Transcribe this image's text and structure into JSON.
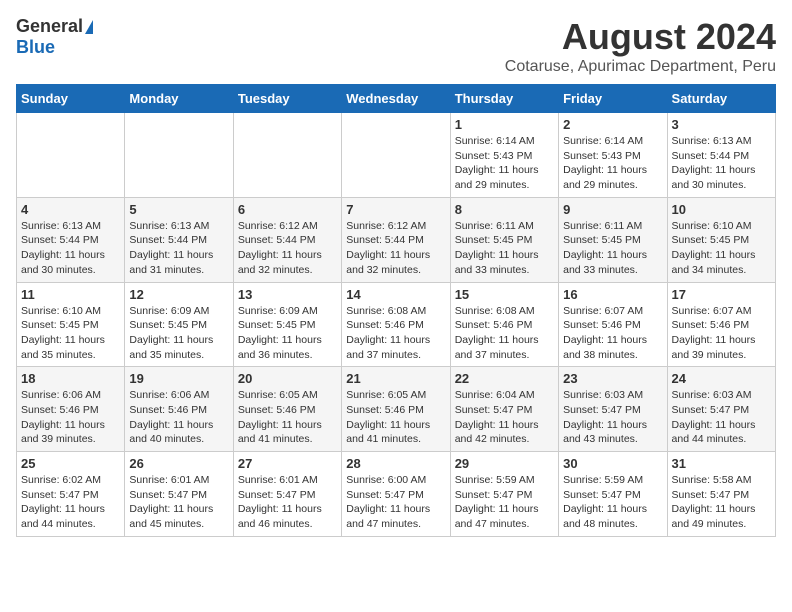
{
  "logo": {
    "general": "General",
    "blue": "Blue"
  },
  "title": "August 2024",
  "subtitle": "Cotaruse, Apurimac Department, Peru",
  "days_of_week": [
    "Sunday",
    "Monday",
    "Tuesday",
    "Wednesday",
    "Thursday",
    "Friday",
    "Saturday"
  ],
  "weeks": [
    [
      {
        "day": "",
        "info": ""
      },
      {
        "day": "",
        "info": ""
      },
      {
        "day": "",
        "info": ""
      },
      {
        "day": "",
        "info": ""
      },
      {
        "day": "1",
        "info": "Sunrise: 6:14 AM\nSunset: 5:43 PM\nDaylight: 11 hours\nand 29 minutes."
      },
      {
        "day": "2",
        "info": "Sunrise: 6:14 AM\nSunset: 5:43 PM\nDaylight: 11 hours\nand 29 minutes."
      },
      {
        "day": "3",
        "info": "Sunrise: 6:13 AM\nSunset: 5:44 PM\nDaylight: 11 hours\nand 30 minutes."
      }
    ],
    [
      {
        "day": "4",
        "info": "Sunrise: 6:13 AM\nSunset: 5:44 PM\nDaylight: 11 hours\nand 30 minutes."
      },
      {
        "day": "5",
        "info": "Sunrise: 6:13 AM\nSunset: 5:44 PM\nDaylight: 11 hours\nand 31 minutes."
      },
      {
        "day": "6",
        "info": "Sunrise: 6:12 AM\nSunset: 5:44 PM\nDaylight: 11 hours\nand 32 minutes."
      },
      {
        "day": "7",
        "info": "Sunrise: 6:12 AM\nSunset: 5:44 PM\nDaylight: 11 hours\nand 32 minutes."
      },
      {
        "day": "8",
        "info": "Sunrise: 6:11 AM\nSunset: 5:45 PM\nDaylight: 11 hours\nand 33 minutes."
      },
      {
        "day": "9",
        "info": "Sunrise: 6:11 AM\nSunset: 5:45 PM\nDaylight: 11 hours\nand 33 minutes."
      },
      {
        "day": "10",
        "info": "Sunrise: 6:10 AM\nSunset: 5:45 PM\nDaylight: 11 hours\nand 34 minutes."
      }
    ],
    [
      {
        "day": "11",
        "info": "Sunrise: 6:10 AM\nSunset: 5:45 PM\nDaylight: 11 hours\nand 35 minutes."
      },
      {
        "day": "12",
        "info": "Sunrise: 6:09 AM\nSunset: 5:45 PM\nDaylight: 11 hours\nand 35 minutes."
      },
      {
        "day": "13",
        "info": "Sunrise: 6:09 AM\nSunset: 5:45 PM\nDaylight: 11 hours\nand 36 minutes."
      },
      {
        "day": "14",
        "info": "Sunrise: 6:08 AM\nSunset: 5:46 PM\nDaylight: 11 hours\nand 37 minutes."
      },
      {
        "day": "15",
        "info": "Sunrise: 6:08 AM\nSunset: 5:46 PM\nDaylight: 11 hours\nand 37 minutes."
      },
      {
        "day": "16",
        "info": "Sunrise: 6:07 AM\nSunset: 5:46 PM\nDaylight: 11 hours\nand 38 minutes."
      },
      {
        "day": "17",
        "info": "Sunrise: 6:07 AM\nSunset: 5:46 PM\nDaylight: 11 hours\nand 39 minutes."
      }
    ],
    [
      {
        "day": "18",
        "info": "Sunrise: 6:06 AM\nSunset: 5:46 PM\nDaylight: 11 hours\nand 39 minutes."
      },
      {
        "day": "19",
        "info": "Sunrise: 6:06 AM\nSunset: 5:46 PM\nDaylight: 11 hours\nand 40 minutes."
      },
      {
        "day": "20",
        "info": "Sunrise: 6:05 AM\nSunset: 5:46 PM\nDaylight: 11 hours\nand 41 minutes."
      },
      {
        "day": "21",
        "info": "Sunrise: 6:05 AM\nSunset: 5:46 PM\nDaylight: 11 hours\nand 41 minutes."
      },
      {
        "day": "22",
        "info": "Sunrise: 6:04 AM\nSunset: 5:47 PM\nDaylight: 11 hours\nand 42 minutes."
      },
      {
        "day": "23",
        "info": "Sunrise: 6:03 AM\nSunset: 5:47 PM\nDaylight: 11 hours\nand 43 minutes."
      },
      {
        "day": "24",
        "info": "Sunrise: 6:03 AM\nSunset: 5:47 PM\nDaylight: 11 hours\nand 44 minutes."
      }
    ],
    [
      {
        "day": "25",
        "info": "Sunrise: 6:02 AM\nSunset: 5:47 PM\nDaylight: 11 hours\nand 44 minutes."
      },
      {
        "day": "26",
        "info": "Sunrise: 6:01 AM\nSunset: 5:47 PM\nDaylight: 11 hours\nand 45 minutes."
      },
      {
        "day": "27",
        "info": "Sunrise: 6:01 AM\nSunset: 5:47 PM\nDaylight: 11 hours\nand 46 minutes."
      },
      {
        "day": "28",
        "info": "Sunrise: 6:00 AM\nSunset: 5:47 PM\nDaylight: 11 hours\nand 47 minutes."
      },
      {
        "day": "29",
        "info": "Sunrise: 5:59 AM\nSunset: 5:47 PM\nDaylight: 11 hours\nand 47 minutes."
      },
      {
        "day": "30",
        "info": "Sunrise: 5:59 AM\nSunset: 5:47 PM\nDaylight: 11 hours\nand 48 minutes."
      },
      {
        "day": "31",
        "info": "Sunrise: 5:58 AM\nSunset: 5:47 PM\nDaylight: 11 hours\nand 49 minutes."
      }
    ]
  ]
}
